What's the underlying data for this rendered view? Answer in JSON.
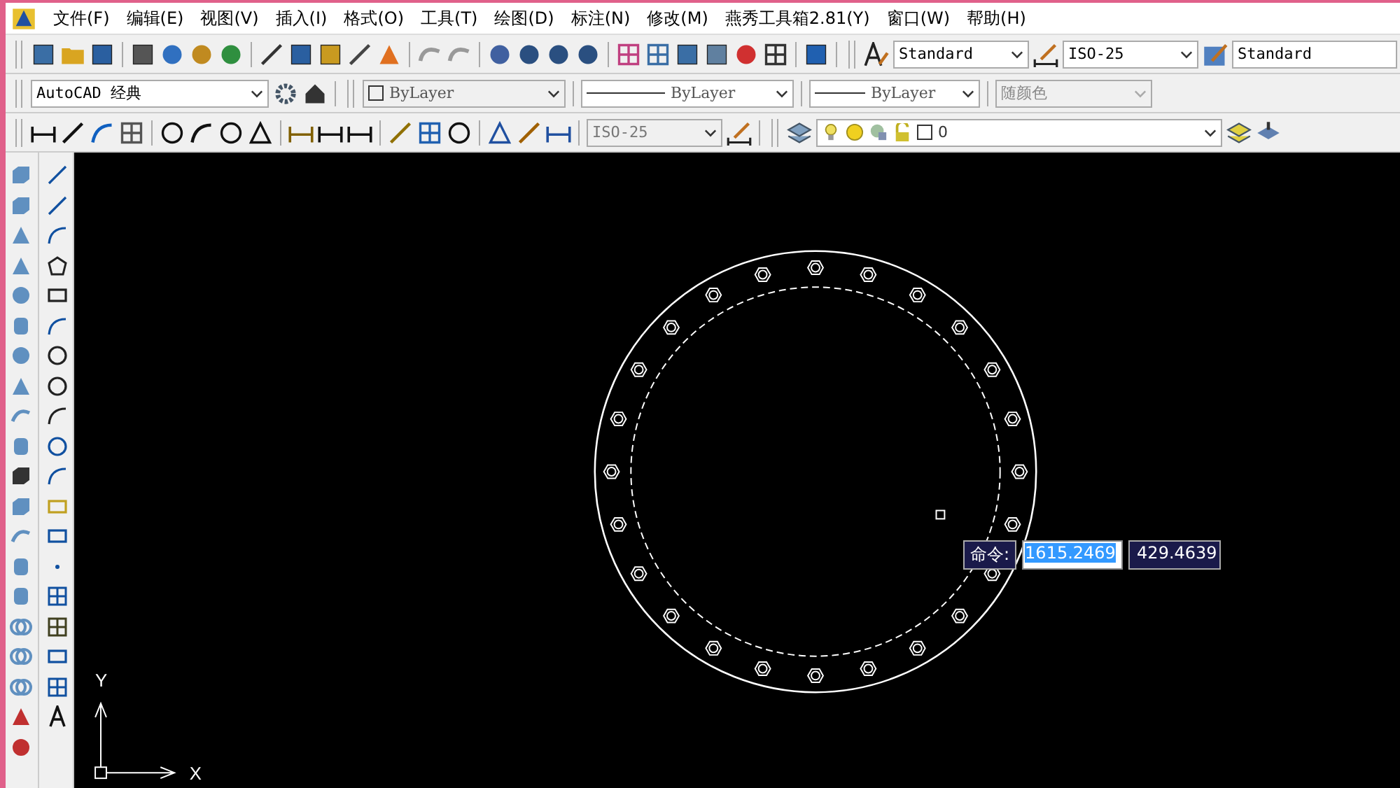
{
  "menu": [
    {
      "label": "文件(F)"
    },
    {
      "label": "编辑(E)"
    },
    {
      "label": "视图(V)"
    },
    {
      "label": "插入(I)"
    },
    {
      "label": "格式(O)"
    },
    {
      "label": "工具(T)"
    },
    {
      "label": "绘图(D)"
    },
    {
      "label": "标注(N)"
    },
    {
      "label": "修改(M)"
    },
    {
      "label": "燕秀工具箱2.81(Y)"
    },
    {
      "label": "窗口(W)"
    },
    {
      "label": "帮助(H)"
    }
  ],
  "styles_toolbar": {
    "text_style": "Standard",
    "dim_style": "ISO-25",
    "table_style": "Standard"
  },
  "workspace": {
    "value": "AutoCAD 经典"
  },
  "properties_toolbar": {
    "color_setting": "ByLayer",
    "linetype": "ByLayer",
    "lineweight": "ByLayer",
    "plot_style": {
      "value": "随颜色",
      "disabled": true
    }
  },
  "dimension_toolbar": {
    "dim_style": "ISO-25"
  },
  "layers_toolbar": {
    "layer": "0"
  },
  "canvas": {
    "ucs_x": "X",
    "ucs_y": "Y"
  },
  "command_tooltip": {
    "label": "命令:",
    "x_value": "1615.2469",
    "x_selected": true,
    "y_value": "429.4639"
  }
}
